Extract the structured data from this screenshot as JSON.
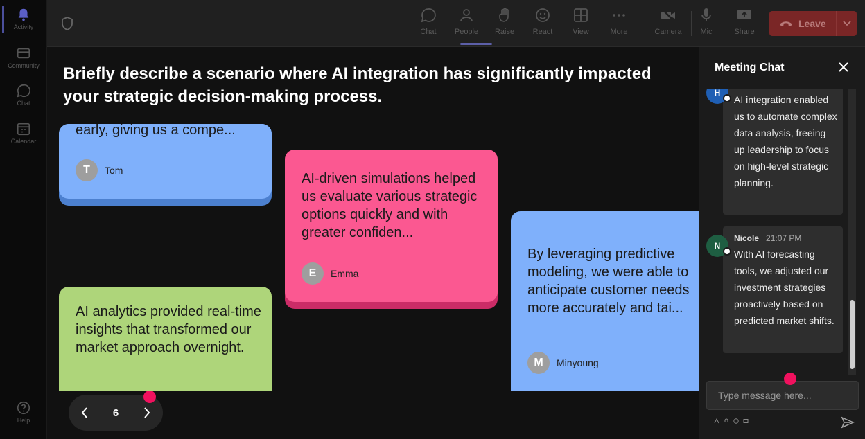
{
  "rail": {
    "items": [
      {
        "label": "Activity",
        "icon": "bell-icon"
      },
      {
        "label": "Community",
        "icon": "community-icon"
      },
      {
        "label": "Chat",
        "icon": "chat-icon"
      },
      {
        "label": "Calendar",
        "icon": "calendar-icon"
      },
      {
        "label": "Help",
        "icon": "help-icon"
      }
    ]
  },
  "toolbar": {
    "chat": "Chat",
    "people": "People",
    "raise": "Raise",
    "react": "React",
    "view": "View",
    "more": "More",
    "camera": "Camera",
    "mic": "Mic",
    "share": "Share",
    "leave": "Leave"
  },
  "stage": {
    "question": "Briefly describe a scenario where AI integration has significantly impacted your strategic decision-making process.",
    "notes": [
      {
        "text": "early, giving us a compe...",
        "author": "Tom",
        "initial": "T",
        "color": "#7fb0fb"
      },
      {
        "text": "AI-driven simulations helped us evaluate various strategic options quickly and with greater confiden...",
        "author": "Emma",
        "initial": "E",
        "color": "#fb5891"
      },
      {
        "text": "By leveraging predictive modeling, we were able to anticipate customer needs more accurately and tai...",
        "author": "Minyoung",
        "initial": "M",
        "color": "#7fb0fb"
      },
      {
        "text": "AI analytics provided real-time insights that transformed our market approach overnight.",
        "author": "",
        "initial": "",
        "color": "#aed57a"
      }
    ],
    "page": "6"
  },
  "chat": {
    "title": "Meeting Chat",
    "messages": [
      {
        "name": "",
        "time": "",
        "initial": "H",
        "avatar_color": "#1f5fb4",
        "text": "AI integration enabled us to automate complex data analysis, freeing up leadership to focus on high-level strategic planning."
      },
      {
        "name": "Nicole",
        "time": "21:07 PM",
        "initial": "N",
        "avatar_color": "#1e5e42",
        "text": "With AI forecasting tools, we adjusted our investment strategies proactively based on predicted market shifts."
      }
    ],
    "input_placeholder": "Type message here..."
  }
}
